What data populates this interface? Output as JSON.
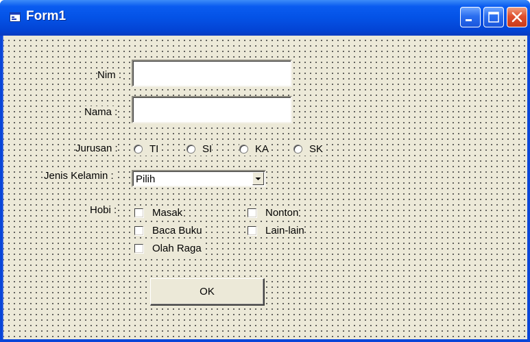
{
  "window": {
    "title": "Form1"
  },
  "form": {
    "nim_label": "Nim :",
    "nim_value": "",
    "nama_label": "Nama :",
    "nama_value": "",
    "jurusan_label": "Jurusan :",
    "jurusan_options": [
      {
        "label": "TI",
        "selected": false
      },
      {
        "label": "SI",
        "selected": false
      },
      {
        "label": "KA",
        "selected": false
      },
      {
        "label": "SK",
        "selected": false
      }
    ],
    "jenis_kelamin_label": "Jenis Kelamin :",
    "jenis_kelamin_value": "Pilih",
    "hobi_label": "Hobi :",
    "hobi_options": [
      {
        "label": "Masak",
        "checked": false
      },
      {
        "label": "Baca Buku",
        "checked": false
      },
      {
        "label": "Olah Raga",
        "checked": false
      },
      {
        "label": "Nonton",
        "checked": false
      },
      {
        "label": "Lain-lain",
        "checked": false
      }
    ],
    "ok_label": "OK"
  },
  "icons": {
    "window_icon": "form-window-icon",
    "minimize": "minimize-icon",
    "maximize": "maximize-icon",
    "close": "close-icon",
    "dropdown": "chevron-down-icon"
  },
  "colors": {
    "titlebar": "#0452e6",
    "client_background": "#ece9d8",
    "close_button": "#e05030"
  }
}
